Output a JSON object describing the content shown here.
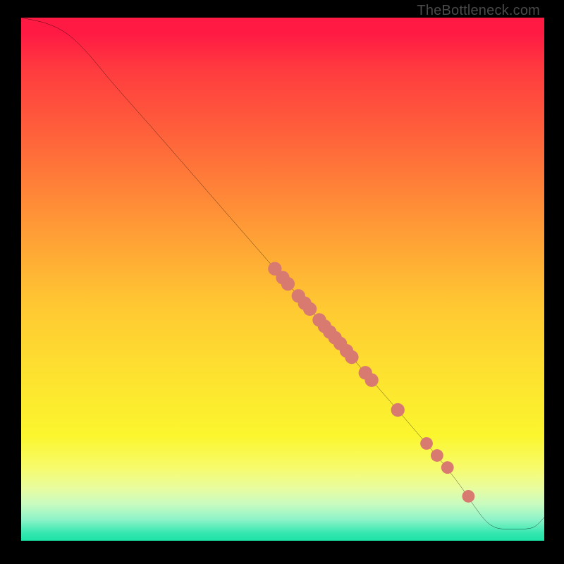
{
  "watermark": "TheBottleneck.com",
  "chart_data": {
    "type": "line",
    "title": "",
    "xlabel": "",
    "ylabel": "",
    "xlim": [
      0,
      100
    ],
    "ylim": [
      0,
      100
    ],
    "curve": [
      {
        "x": 0,
        "y": 100
      },
      {
        "x": 5,
        "y": 99
      },
      {
        "x": 9,
        "y": 97
      },
      {
        "x": 13,
        "y": 93
      },
      {
        "x": 17,
        "y": 88
      },
      {
        "x": 25,
        "y": 79
      },
      {
        "x": 35,
        "y": 67.5
      },
      {
        "x": 45,
        "y": 56
      },
      {
        "x": 55,
        "y": 44.5
      },
      {
        "x": 65,
        "y": 33
      },
      {
        "x": 75,
        "y": 21.5
      },
      {
        "x": 83,
        "y": 12
      },
      {
        "x": 87,
        "y": 6
      },
      {
        "x": 89,
        "y": 3.5
      },
      {
        "x": 90.5,
        "y": 2.5
      },
      {
        "x": 92,
        "y": 2.2
      },
      {
        "x": 97,
        "y": 2.2
      },
      {
        "x": 98.5,
        "y": 2.8
      },
      {
        "x": 100,
        "y": 4.5
      }
    ],
    "markers": [
      {
        "x": 48.5,
        "y": 52.0,
        "size": 1.3
      },
      {
        "x": 50.0,
        "y": 50.3,
        "size": 1.3
      },
      {
        "x": 51.0,
        "y": 49.1,
        "size": 1.3
      },
      {
        "x": 53.0,
        "y": 46.8,
        "size": 1.3
      },
      {
        "x": 54.2,
        "y": 45.4,
        "size": 1.3
      },
      {
        "x": 55.2,
        "y": 44.3,
        "size": 1.3
      },
      {
        "x": 57.0,
        "y": 42.2,
        "size": 1.3
      },
      {
        "x": 58.0,
        "y": 41.0,
        "size": 1.3
      },
      {
        "x": 59.0,
        "y": 39.9,
        "size": 1.3
      },
      {
        "x": 60.0,
        "y": 38.8,
        "size": 1.3
      },
      {
        "x": 61.0,
        "y": 37.7,
        "size": 1.3
      },
      {
        "x": 62.2,
        "y": 36.3,
        "size": 1.3
      },
      {
        "x": 63.2,
        "y": 35.1,
        "size": 1.3
      },
      {
        "x": 65.8,
        "y": 32.1,
        "size": 1.3
      },
      {
        "x": 67.0,
        "y": 30.7,
        "size": 1.3
      },
      {
        "x": 72.0,
        "y": 25.0,
        "size": 1.3
      },
      {
        "x": 77.5,
        "y": 18.6,
        "size": 1.2
      },
      {
        "x": 79.5,
        "y": 16.3,
        "size": 1.2
      },
      {
        "x": 81.5,
        "y": 14.0,
        "size": 1.2
      },
      {
        "x": 85.5,
        "y": 8.5,
        "size": 1.2
      }
    ],
    "marker_color": "#d97a70",
    "line_color": "#000000"
  }
}
